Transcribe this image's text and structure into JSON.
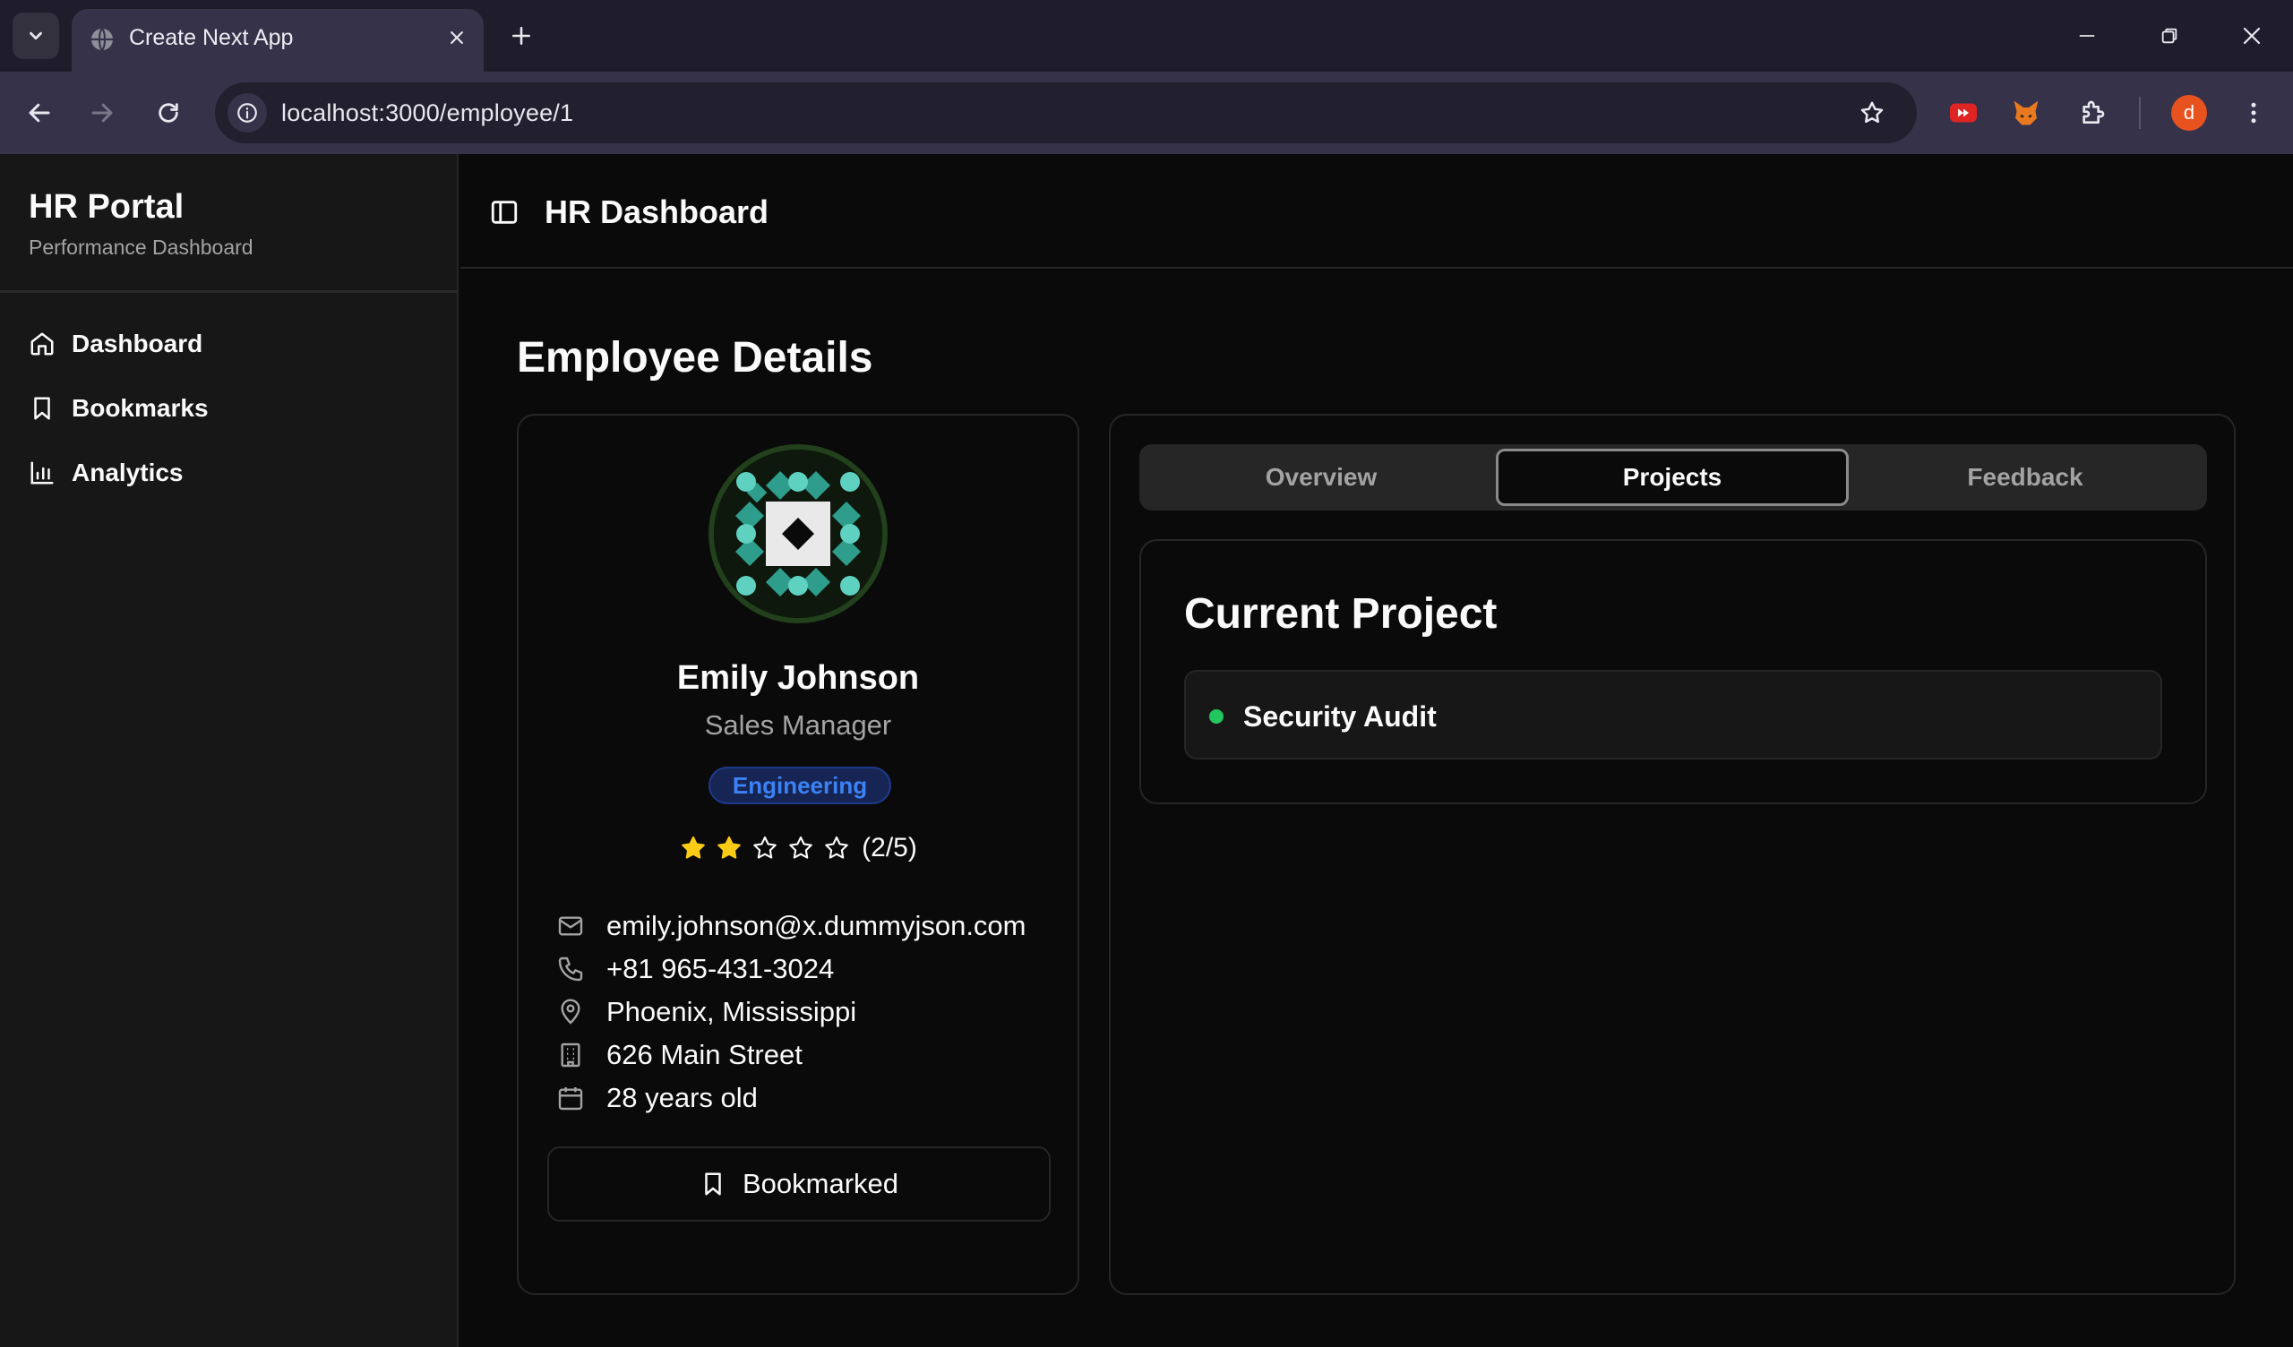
{
  "browser": {
    "tab_title": "Create Next App",
    "url": "localhost:3000/employee/1",
    "profile_initial": "d"
  },
  "sidebar": {
    "app_name": "HR Portal",
    "app_subtitle": "Performance Dashboard",
    "items": [
      {
        "label": "Dashboard",
        "icon": "home-icon"
      },
      {
        "label": "Bookmarks",
        "icon": "bookmark-icon"
      },
      {
        "label": "Analytics",
        "icon": "bar-chart-icon"
      }
    ]
  },
  "header": {
    "title": "HR Dashboard"
  },
  "page": {
    "title": "Employee Details"
  },
  "employee": {
    "name": "Emily Johnson",
    "role": "Sales Manager",
    "department": "Engineering",
    "rating": 2,
    "rating_max": 5,
    "rating_text": "(2/5)",
    "email": "emily.johnson@x.dummyjson.com",
    "phone": "+81 965-431-3024",
    "location": "Phoenix, Mississippi",
    "address": "626 Main Street",
    "age": "28 years old",
    "bookmark_label": "Bookmarked"
  },
  "tabs": [
    {
      "label": "Overview",
      "active": false
    },
    {
      "label": "Projects",
      "active": true
    },
    {
      "label": "Feedback",
      "active": false
    }
  ],
  "projects": {
    "title": "Current Project",
    "items": [
      {
        "name": "Security Audit",
        "status_color": "#22c55e"
      }
    ]
  },
  "colors": {
    "background": "#0a0a0a",
    "sidebar": "#171717",
    "badge_text": "#3b82f6",
    "star": "#facc15",
    "browser_frame": "#35324a"
  }
}
